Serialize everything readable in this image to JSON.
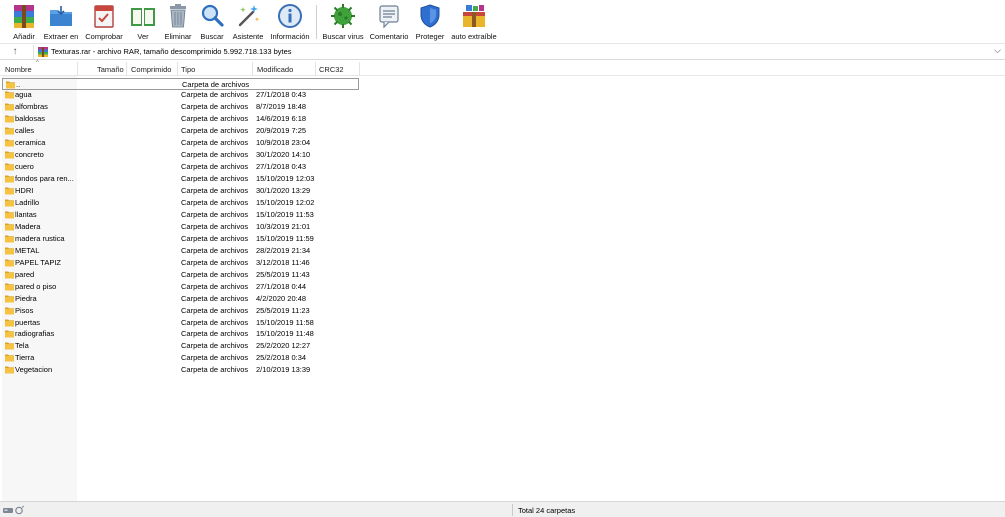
{
  "toolbar": {
    "buttons": [
      {
        "label": "Añadir",
        "icon": "add-archive-icon"
      },
      {
        "label": "Extraer en",
        "icon": "extract-folder-icon"
      },
      {
        "label": "Comprobar",
        "icon": "test-archive-icon"
      },
      {
        "label": "Ver",
        "icon": "view-book-icon"
      },
      {
        "label": "Eliminar",
        "icon": "trash-icon"
      },
      {
        "label": "Buscar",
        "icon": "magnifier-icon"
      },
      {
        "label": "Asistente",
        "icon": "wizard-wand-icon"
      },
      {
        "label": "Información",
        "icon": "info-icon"
      },
      {
        "label": "Buscar virus",
        "icon": "virus-scan-icon"
      },
      {
        "label": "Comentario",
        "icon": "comment-icon"
      },
      {
        "label": "Proteger",
        "icon": "shield-icon"
      },
      {
        "label": "auto extraíble",
        "icon": "sfx-archive-icon"
      }
    ]
  },
  "address": {
    "text": "Texturas.rar - archivo RAR, tamaño descomprimido 5.992.718.133 bytes",
    "dropdown_glyph": "⌵",
    "up_glyph": "↑"
  },
  "columns": {
    "name": "Nombre",
    "size": "Tamaño",
    "packed": "Comprimido",
    "type": "Tipo",
    "modified": "Modificado",
    "crc": "CRC32"
  },
  "rows": [
    {
      "name": "..",
      "type": "Carpeta de archivos",
      "modified": ""
    },
    {
      "name": "agua",
      "type": "Carpeta de archivos",
      "modified": "27/1/2018 0:43"
    },
    {
      "name": "alfombras",
      "type": "Carpeta de archivos",
      "modified": "8/7/2019 18:48"
    },
    {
      "name": "baldosas",
      "type": "Carpeta de archivos",
      "modified": "14/6/2019 6:18"
    },
    {
      "name": "calles",
      "type": "Carpeta de archivos",
      "modified": "20/9/2019 7:25"
    },
    {
      "name": "ceramica",
      "type": "Carpeta de archivos",
      "modified": "10/9/2018 23:04"
    },
    {
      "name": "concreto",
      "type": "Carpeta de archivos",
      "modified": "30/1/2020 14:10"
    },
    {
      "name": "cuero",
      "type": "Carpeta de archivos",
      "modified": "27/1/2018 0:43"
    },
    {
      "name": "fondos para ren...",
      "type": "Carpeta de archivos",
      "modified": "15/10/2019 12:03"
    },
    {
      "name": "HDRI",
      "type": "Carpeta de archivos",
      "modified": "30/1/2020 13:29"
    },
    {
      "name": "Ladrillo",
      "type": "Carpeta de archivos",
      "modified": "15/10/2019 12:02"
    },
    {
      "name": "llantas",
      "type": "Carpeta de archivos",
      "modified": "15/10/2019 11:53"
    },
    {
      "name": "Madera",
      "type": "Carpeta de archivos",
      "modified": "10/3/2019 21:01"
    },
    {
      "name": "madera rustica",
      "type": "Carpeta de archivos",
      "modified": "15/10/2019 11:59"
    },
    {
      "name": "METAL",
      "type": "Carpeta de archivos",
      "modified": "28/2/2019 21:34"
    },
    {
      "name": "PAPEL TAPIZ",
      "type": "Carpeta de archivos",
      "modified": "3/12/2018 11:46"
    },
    {
      "name": "pared",
      "type": "Carpeta de archivos",
      "modified": "25/5/2019 11:43"
    },
    {
      "name": "pared o piso",
      "type": "Carpeta de archivos",
      "modified": "27/1/2018 0:44"
    },
    {
      "name": "Piedra",
      "type": "Carpeta de archivos",
      "modified": "4/2/2020 20:48"
    },
    {
      "name": "Pisos",
      "type": "Carpeta de archivos",
      "modified": "25/5/2019 11:23"
    },
    {
      "name": "puertas",
      "type": "Carpeta de archivos",
      "modified": "15/10/2019 11:58"
    },
    {
      "name": "radiografias",
      "type": "Carpeta de archivos",
      "modified": "15/10/2019 11:48"
    },
    {
      "name": "Tela",
      "type": "Carpeta de archivos",
      "modified": "25/2/2020 12:27"
    },
    {
      "name": "Tierra",
      "type": "Carpeta de archivos",
      "modified": "25/2/2018 0:34"
    },
    {
      "name": "Vegetacion",
      "type": "Carpeta de archivos",
      "modified": "2/10/2019 13:39"
    }
  ],
  "status": {
    "text": "Total 24 carpetas"
  },
  "colors": {
    "folder": "#f5c242",
    "folder_dark": "#d9a326",
    "focus_border": "#9a9a9a"
  }
}
